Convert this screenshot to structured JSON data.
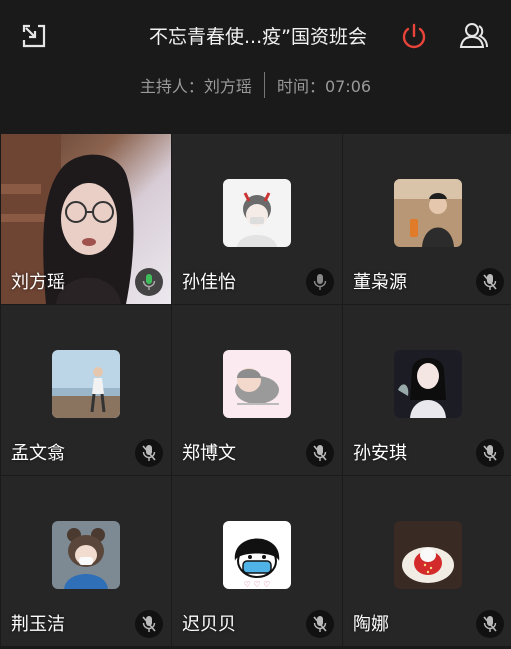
{
  "header": {
    "title": "不忘青春使...疫”国资班会",
    "host_label": "主持人：刘方瑶",
    "time_label": "时间：07:06"
  },
  "colors": {
    "background": "#1a1a1a",
    "tile": "#262626",
    "power_accent": "#e8443a",
    "muted_text": "#9a9a9a"
  },
  "participants": [
    {
      "name": "刘方瑶",
      "mic": "active",
      "role": "host"
    },
    {
      "name": "孙佳怡",
      "mic": "on"
    },
    {
      "name": "董枭源",
      "mic": "muted"
    },
    {
      "name": "孟文翕",
      "mic": "muted"
    },
    {
      "name": "郑博文",
      "mic": "muted"
    },
    {
      "name": "孙安琪",
      "mic": "muted"
    },
    {
      "name": "荆玉洁",
      "mic": "muted"
    },
    {
      "name": "迟贝贝",
      "mic": "muted"
    },
    {
      "name": "陶娜",
      "mic": "muted"
    }
  ]
}
